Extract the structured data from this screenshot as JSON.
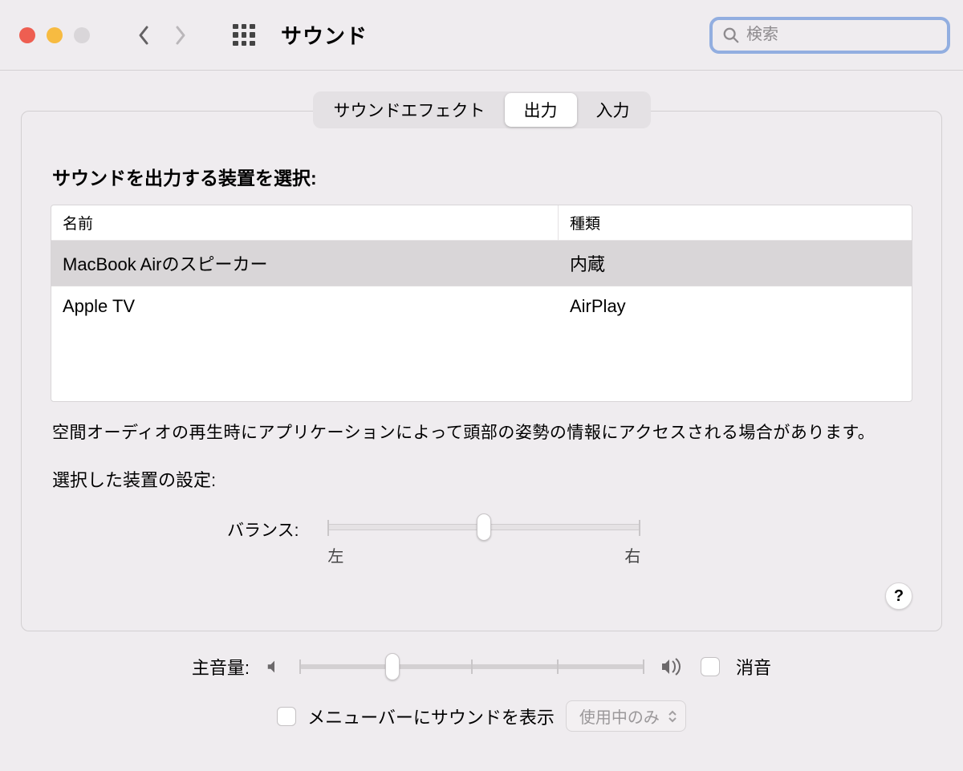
{
  "window": {
    "title": "サウンド"
  },
  "search": {
    "placeholder": "検索"
  },
  "tabs": {
    "effects": "サウンドエフェクト",
    "output": "出力",
    "input": "入力"
  },
  "sectionTitle": "サウンドを出力する装置を選択:",
  "table": {
    "headers": {
      "name": "名前",
      "type": "種類"
    },
    "rows": [
      {
        "name": "MacBook Airのスピーカー",
        "type": "内蔵",
        "selected": true
      },
      {
        "name": "Apple TV",
        "type": "AirPlay",
        "selected": false
      }
    ]
  },
  "note": "空間オーディオの再生時にアプリケーションによって頭部の姿勢の情報にアクセスされる場合があります。",
  "deviceSettings": "選択した装置の設定:",
  "balance": {
    "label": "バランス:",
    "left": "左",
    "right": "右"
  },
  "help": "?",
  "mainVolume": {
    "label": "主音量:",
    "mute": "消音"
  },
  "menubar": {
    "label": "メニューバーにサウンドを表示",
    "popup": "使用中のみ"
  }
}
